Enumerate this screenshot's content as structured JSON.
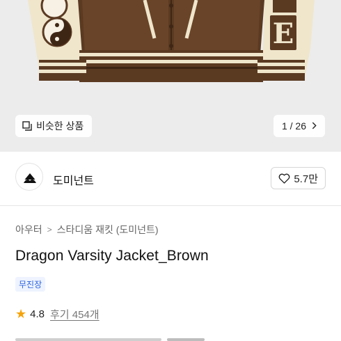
{
  "hero": {
    "similar_label": "비슷한 상품",
    "counter": "1 / 26"
  },
  "icons": {
    "similar": "similar-products-icon",
    "chevron": "chevron-right-icon",
    "heart": "heart-icon",
    "star": "star-icon",
    "brand_logo": "brand-logo"
  },
  "brand": {
    "name": "도미넌트",
    "likes": "5.7만"
  },
  "breadcrumb": {
    "category": "아우터",
    "subcategory": "스타디움 재킷 (도미넌트)"
  },
  "product": {
    "title": "Dragon Varsity Jacket_Brown",
    "badge": "무진장"
  },
  "rating": {
    "score": "4.8",
    "reviews": "후기 454개"
  },
  "colors": {
    "badge_bg": "#eef3ff",
    "badge_text": "#2c63e0",
    "star": "#f5a30a",
    "jacket_body": "#5b3a22",
    "jacket_sleeve": "#efe6cc"
  }
}
